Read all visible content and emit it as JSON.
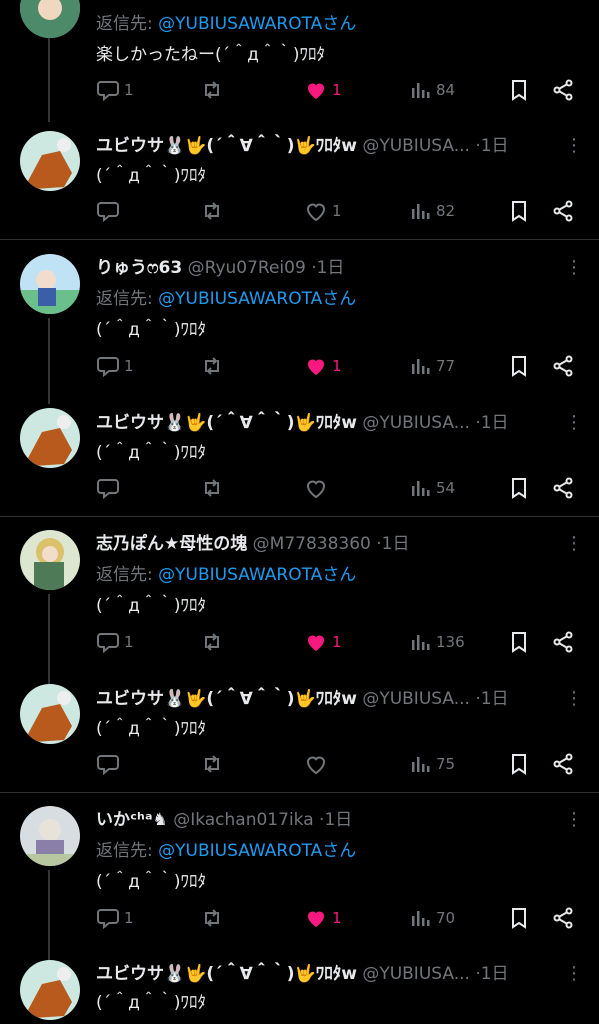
{
  "icons": {
    "comment": "comment-icon",
    "retweet": "retweet-icon",
    "like": "heart-icon",
    "views": "views-icon",
    "bookmark": "bookmark-icon",
    "share": "share-icon",
    "more": "more-icon"
  },
  "colors": {
    "background": "#000000",
    "text": "#e7e9ea",
    "muted": "#71767b",
    "link": "#1d9bf0",
    "like": "#f91880",
    "divider": "#2f3336"
  },
  "reply_prefix": "返信先:",
  "reply_target": "@YUBIUSAWAROTAさん",
  "groups": [
    {
      "reply": {
        "text": "楽しかったねー(´＾д＾｀)ﾜﾛﾀ",
        "comments": "1",
        "retweets": "",
        "likes": "1",
        "views": "84",
        "liked": true
      },
      "response": {
        "name": "ユビウサ🐰🤟(´＾∀＾｀)🤟ﾜﾛﾀw",
        "handle": "@YUBIUSA...",
        "dot": "·",
        "time": "1日",
        "text": "(´＾д＾｀)ﾜﾛﾀ",
        "comments": "",
        "retweets": "",
        "likes": "1",
        "views": "82",
        "liked": false
      }
    },
    {
      "reply": {
        "name": "りゅうෆ63",
        "handle": "@Ryu07Rei09",
        "dot": "·",
        "time": "1日",
        "text": "(´＾д＾｀)ﾜﾛﾀ",
        "comments": "1",
        "retweets": "",
        "likes": "1",
        "views": "77",
        "liked": true
      },
      "response": {
        "name": "ユビウサ🐰🤟(´＾∀＾｀)🤟ﾜﾛﾀw",
        "handle": "@YUBIUSA...",
        "dot": "·",
        "time": "1日",
        "text": "(´＾д＾｀)ﾜﾛﾀ",
        "comments": "",
        "retweets": "",
        "likes": "",
        "views": "54",
        "liked": false
      }
    },
    {
      "reply": {
        "name": "志乃ぽん★母性の塊",
        "handle": "@M77838360",
        "dot": "·",
        "time": "1日",
        "text": "(´＾д＾｀)ﾜﾛﾀ",
        "comments": "1",
        "retweets": "",
        "likes": "1",
        "views": "136",
        "liked": true
      },
      "response": {
        "name": "ユビウサ🐰🤟(´＾∀＾｀)🤟ﾜﾛﾀw",
        "handle": "@YUBIUSA...",
        "dot": "·",
        "time": "1日",
        "text": "(´＾д＾｀)ﾜﾛﾀ",
        "comments": "",
        "retweets": "",
        "likes": "",
        "views": "75",
        "liked": false
      }
    },
    {
      "reply": {
        "name": "いかᶜʰᵃ♞",
        "handle": "@Ikachan017ika",
        "dot": "·",
        "time": "1日",
        "text": "(´＾д＾｀)ﾜﾛﾀ",
        "comments": "1",
        "retweets": "",
        "likes": "1",
        "views": "70",
        "liked": true
      },
      "response": {
        "name": "ユビウサ🐰🤟(´＾∀＾｀)🤟ﾜﾛﾀw",
        "handle": "@YUBIUSA...",
        "dot": "·",
        "time": "1日",
        "text": "(´＾д＾｀)ﾜﾛﾀ"
      }
    }
  ]
}
